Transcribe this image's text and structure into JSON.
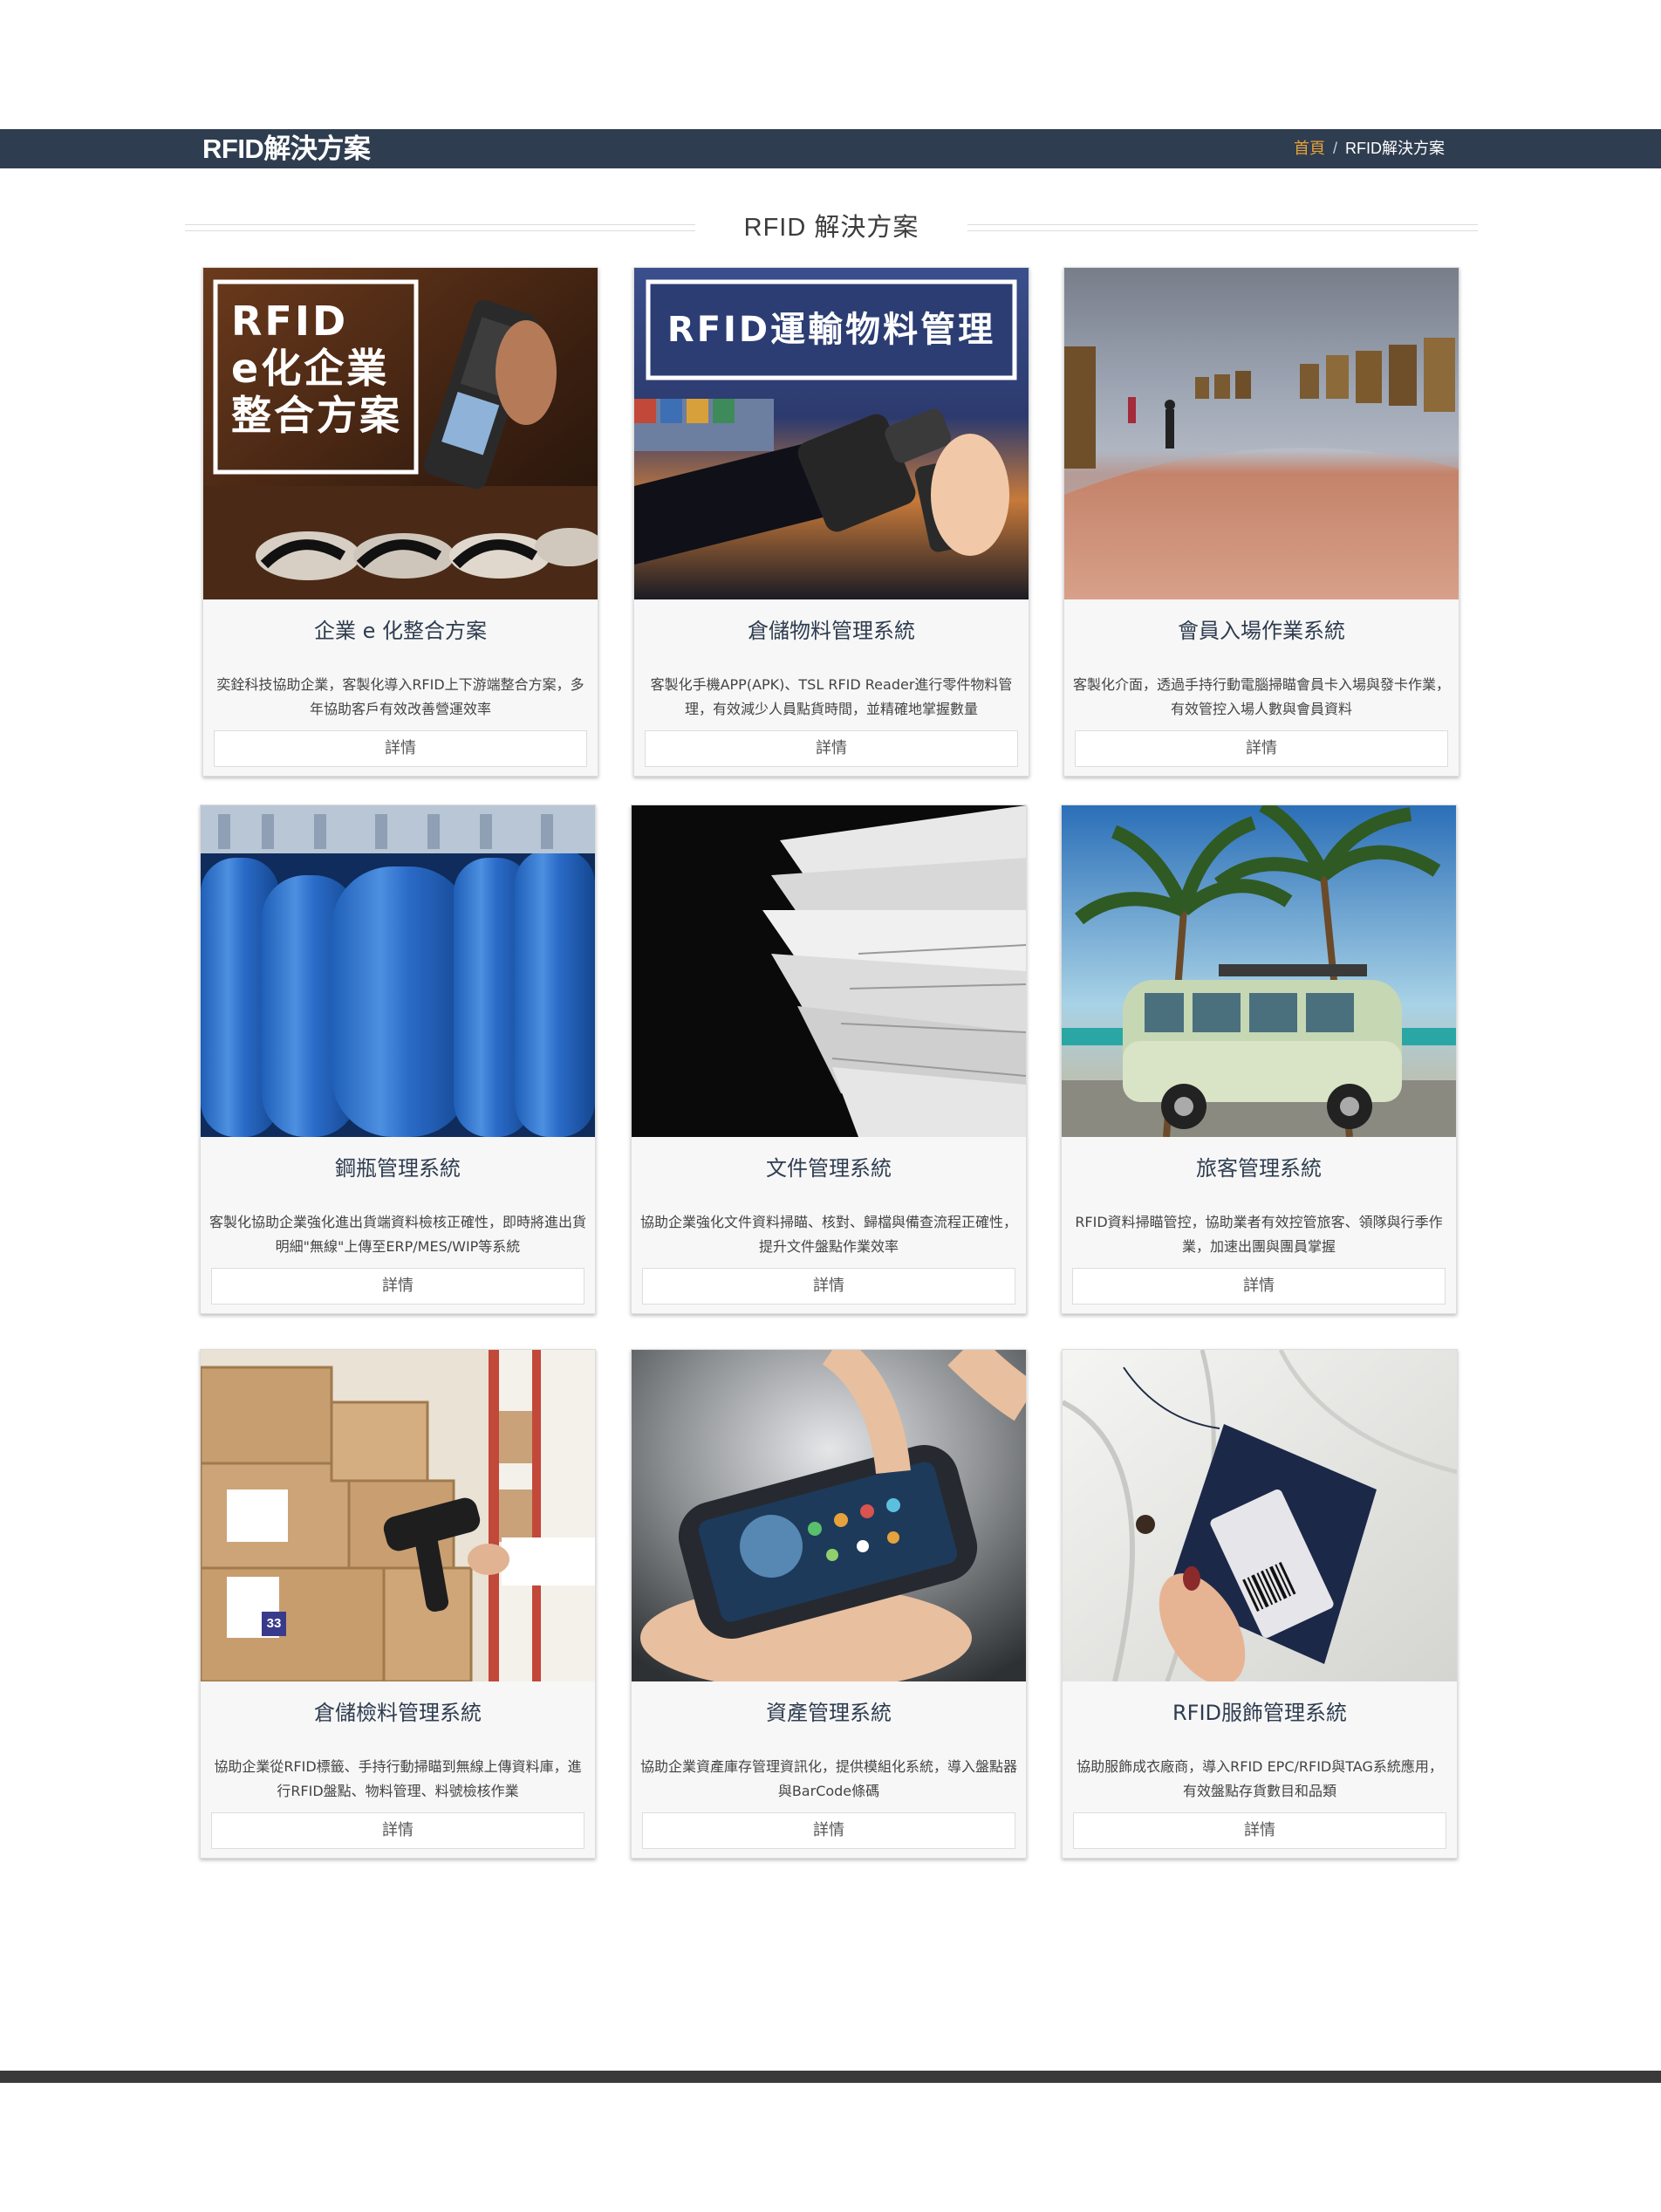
{
  "header": {
    "title": "RFID解決方案",
    "breadcrumb": {
      "home": "首頁",
      "separator": "/",
      "current": "RFID解決方案"
    }
  },
  "section": {
    "heading": "RFID 解決方案"
  },
  "cards": [
    {
      "title": "企業 e 化整合方案",
      "image_text": [
        "RFID",
        "e化企業",
        "整合方案"
      ],
      "description": "奕銓科技協助企業，客製化導入RFID上下游端整合方案，多年協助客戶有效改善營運效率",
      "button": "詳情"
    },
    {
      "title": "倉儲物料管理系統",
      "image_text": [
        "RFID運輸物料管理"
      ],
      "description": "客製化手機APP(APK)、TSL RFID Reader進行零件物料管理，有效減少人員點貨時間，並精確地掌握數量",
      "button": "詳情"
    },
    {
      "title": "會員入場作業系統",
      "description": "客製化介面，透過手持行動電腦掃瞄會員卡入場與發卡作業，有效管控入場人數與會員資料",
      "button": "詳情"
    },
    {
      "title": "鋼瓶管理系統",
      "description": "客製化協助企業強化進出貨端資料檢核正確性，即時將進出貨明細\"無線\"上傳至ERP/MES/WIP等系統",
      "button": "詳情"
    },
    {
      "title": "文件管理系統",
      "description": "協助企業強化文件資料掃瞄、核對、歸檔與備查流程正確性，提升文件盤點作業效率",
      "button": "詳情"
    },
    {
      "title": "旅客管理系統",
      "description": "RFID資料掃瞄管控，協助業者有效控管旅客、領隊與行季作業，加速出團與團員掌握",
      "button": "詳情"
    },
    {
      "title": "倉儲檢料管理系統",
      "image_text": [
        "33"
      ],
      "description": "協助企業從RFID標籤、手持行動掃瞄到無線上傳資料庫，進行RFID盤點、物料管理、料號檢核作業",
      "button": "詳情"
    },
    {
      "title": "資產管理系統",
      "description": "協助企業資產庫存管理資訊化，提供模組化系統，導入盤點器與BarCode條碼",
      "button": "詳情"
    },
    {
      "title": "RFID服飾管理系統",
      "description": "協助服飾成衣廠商，導入RFID EPC/RFID與TAG系統應用，有效盤點存貨數目和品類",
      "button": "詳情"
    }
  ],
  "colors": {
    "header_bar": "#2f3d50",
    "breadcrumb_home": "#e6a23c",
    "card_background": "#f7f7f7",
    "footer_bar": "#3a3a3a"
  }
}
